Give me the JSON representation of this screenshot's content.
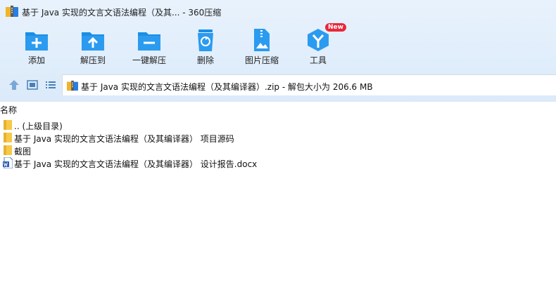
{
  "window": {
    "title": "基于 Java 实现的文言文语法编程（及其... - 360压缩"
  },
  "toolbar": {
    "buttons": [
      {
        "label": "添加",
        "icon": "add-icon"
      },
      {
        "label": "解压到",
        "icon": "extract-to-icon"
      },
      {
        "label": "一键解压",
        "icon": "one-click-extract-icon"
      },
      {
        "label": "删除",
        "icon": "recycle-delete-icon"
      },
      {
        "label": "图片压缩",
        "icon": "image-compress-icon"
      },
      {
        "label": "工具",
        "icon": "tools-icon",
        "badge": "New"
      }
    ]
  },
  "address": {
    "path": "基于 Java 实现的文言文语法编程（及其编译器）.zip - 解包大小为 206.6 MB"
  },
  "list": {
    "header": "名称",
    "items": [
      {
        "name": ".. (上级目录)",
        "type": "folder"
      },
      {
        "name": "基于 Java 实现的文言文语法编程（及其编译器） 项目源码",
        "type": "folder"
      },
      {
        "name": "截图",
        "type": "folder"
      },
      {
        "name": "基于 Java 实现的文言文语法编程（及其编译器） 设计报告.docx",
        "type": "word"
      }
    ]
  },
  "colors": {
    "chrome_bg": "#dbeafa",
    "icon_blue": "#1b8fe5",
    "folder_yellow": "#f7c948",
    "badge_red": "#e8283a"
  }
}
